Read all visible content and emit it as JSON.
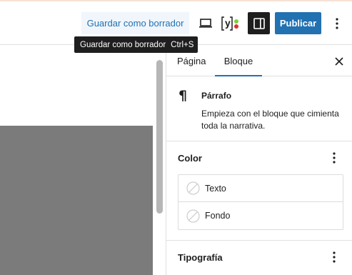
{
  "header": {
    "save_draft_label": "Guardar como borrador",
    "publish_label": "Publicar",
    "tooltip": {
      "label": "Guardar como borrador",
      "shortcut": "Ctrl+S"
    },
    "yoast_logo": "y",
    "icons": {
      "preview": "laptop-icon",
      "yoast": "yoast-icon",
      "settings": "sidebar-panel-icon",
      "more": "more-vertical-icon"
    }
  },
  "sidebar": {
    "tabs": [
      {
        "label": "Página"
      },
      {
        "label": "Bloque"
      }
    ],
    "active_tab": "Bloque",
    "close_icon": "close-icon",
    "block_card": {
      "icon": "paragraph-icon",
      "title": "Párrafo",
      "description": "Empieza con el bloque que cimienta toda la narrativa."
    },
    "color_panel": {
      "title": "Color",
      "items": [
        {
          "label": "Texto",
          "icon": "empty-swatch-icon"
        },
        {
          "label": "Fondo",
          "icon": "empty-swatch-icon"
        }
      ]
    },
    "typography_panel": {
      "title": "Tipografía"
    }
  },
  "colors": {
    "accent": "#2271b1",
    "draft_bg": "#f0f6fc",
    "dark": "#1e1e1e",
    "placeholder_block": "#7b7b7b",
    "yoast_red": "#dc3232",
    "yoast_green": "#7ad03a"
  }
}
